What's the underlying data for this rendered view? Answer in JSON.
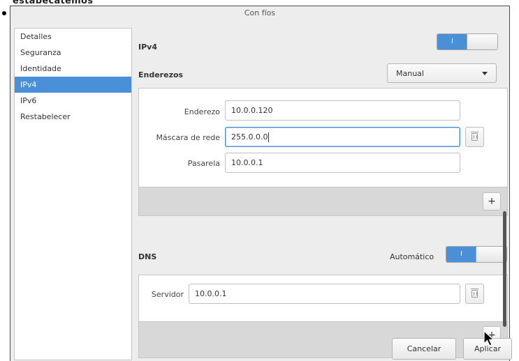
{
  "page": {
    "cut_text": "estabecatemos"
  },
  "window": {
    "title": "Con fíos"
  },
  "sidebar": {
    "items": [
      {
        "label": "Detalles"
      },
      {
        "label": "Seguranza"
      },
      {
        "label": "Identidade"
      },
      {
        "label": "IPv4",
        "selected": true
      },
      {
        "label": "IPv6"
      },
      {
        "label": "Restabelecer"
      }
    ]
  },
  "ipv4": {
    "title": "IPv4",
    "toggle_on": "I",
    "enabled": true,
    "addresses_label": "Enderezos",
    "method": "Manual",
    "fields": {
      "address_label": "Enderezo",
      "address_value": "10.0.0.120",
      "netmask_label": "Máscara de rede",
      "netmask_value": "255.0.0.0",
      "gateway_label": "Pasarela",
      "gateway_value": "10.0.0.1"
    },
    "add_label": "+"
  },
  "dns": {
    "title": "DNS",
    "auto_label": "Automático",
    "toggle_on": "I",
    "automatic": true,
    "server_label": "Servidor",
    "server_value": "10.0.0.1",
    "add_label": "+"
  },
  "actions": {
    "cancel": "Cancelar",
    "apply": "Aplicar"
  },
  "colors": {
    "accent": "#4a90d9",
    "selected_bg": "#4a90d9"
  }
}
